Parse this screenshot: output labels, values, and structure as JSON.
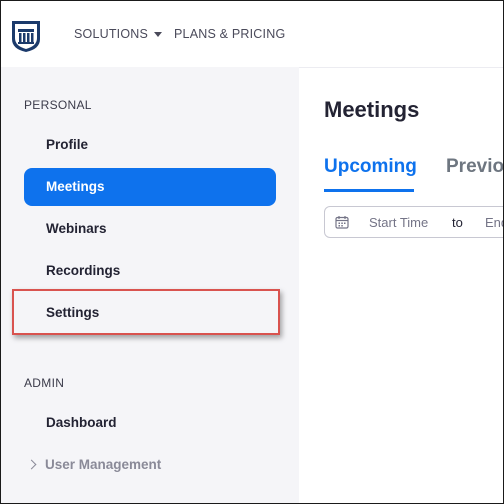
{
  "nav": {
    "logo_icon": "shield-logo-icon",
    "solutions": "SOLUTIONS",
    "plans": "PLANS & PRICING"
  },
  "sidebar": {
    "personal_label": "PERSONAL",
    "items": [
      {
        "label": "Profile"
      },
      {
        "label": "Meetings",
        "active": true
      },
      {
        "label": "Webinars"
      },
      {
        "label": "Recordings"
      },
      {
        "label": "Settings",
        "highlighted": true
      }
    ],
    "admin_label": "ADMIN",
    "admin_items": [
      {
        "label": "Dashboard"
      },
      {
        "label": "User Management",
        "icon": "chevron-right-icon"
      }
    ]
  },
  "main": {
    "title": "Meetings",
    "tabs": [
      {
        "label": "Upcoming",
        "active": true
      },
      {
        "label": "Previo"
      }
    ],
    "date_filter": {
      "icon": "calendar-icon",
      "start": "Start Time",
      "to": "to",
      "end": "End"
    }
  },
  "colors": {
    "accent": "#0e72ed",
    "highlight_border": "#d9534f",
    "sidebar_bg": "#f5f5f8"
  }
}
